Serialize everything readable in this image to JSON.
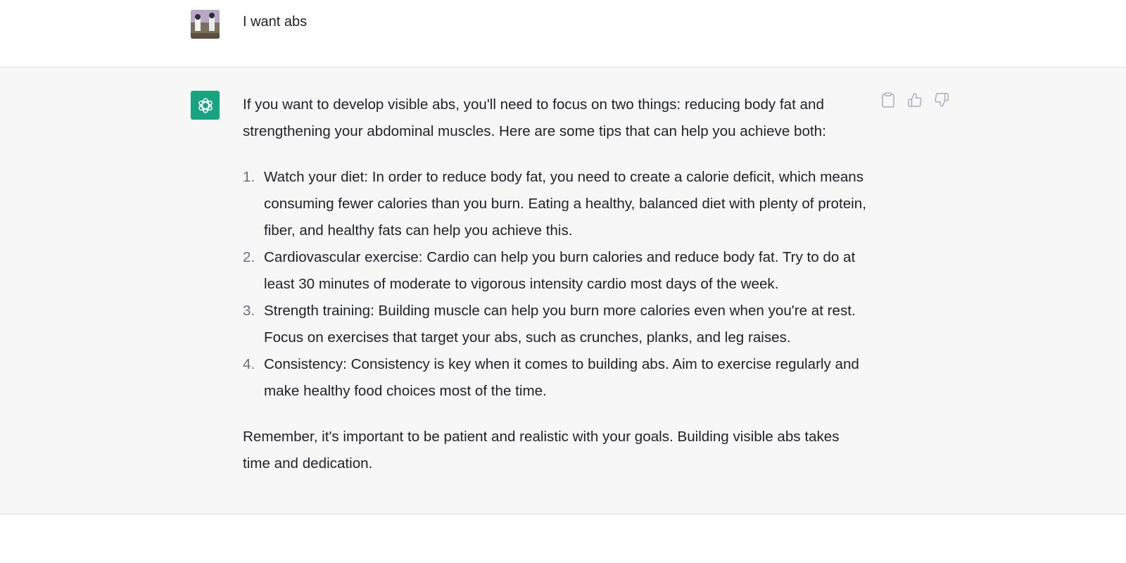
{
  "user_message": {
    "text": "I want abs"
  },
  "assistant_message": {
    "intro": "If you want to develop visible abs, you'll need to focus on two things: reducing body fat and strengthening your abdominal muscles. Here are some tips that can help you achieve both:",
    "tips": [
      {
        "number": "1.",
        "text": "Watch your diet: In order to reduce body fat, you need to create a calorie deficit, which means consuming fewer calories than you burn. Eating a healthy, balanced diet with plenty of protein, fiber, and healthy fats can help you achieve this."
      },
      {
        "number": "2.",
        "text": "Cardiovascular exercise: Cardio can help you burn calories and reduce body fat. Try to do at least 30 minutes of moderate to vigorous intensity cardio most days of the week."
      },
      {
        "number": "3.",
        "text": "Strength training: Building muscle can help you burn more calories even when you're at rest. Focus on exercises that target your abs, such as crunches, planks, and leg raises."
      },
      {
        "number": "4.",
        "text": "Consistency: Consistency is key when it comes to building abs. Aim to exercise regularly and make healthy food choices most of the time."
      }
    ],
    "outro": "Remember, it's important to be patient and realistic with your goals. Building visible abs takes time and dedication.",
    "actions": [
      "clipboard-icon",
      "thumbs-up-icon",
      "thumbs-down-icon"
    ]
  },
  "colors": {
    "assistant_bg": "#f7f7f8",
    "avatar_green": "#19a37f",
    "text": "#1f2128",
    "list_number": "#6e6e80",
    "icon_gray": "#acacbe"
  }
}
